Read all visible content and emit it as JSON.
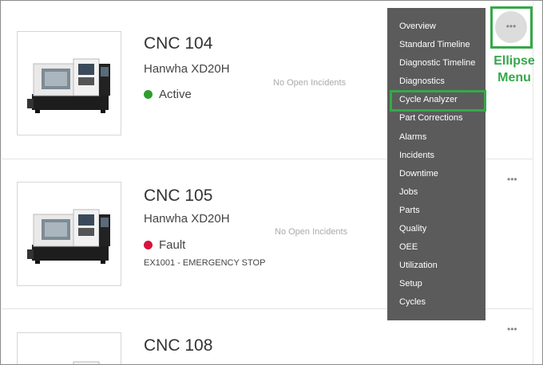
{
  "machines": [
    {
      "name": "CNC 104",
      "model": "Hanwha  XD20H",
      "status": "Active",
      "status_color": "#2e9e2e",
      "incidents": "No Open Incidents",
      "fault": ""
    },
    {
      "name": "CNC 105",
      "model": "Hanwha  XD20H",
      "status": "Fault",
      "status_color": "#d8143c",
      "incidents": "No Open Incidents",
      "fault": "EX1001 - EMERGENCY STOP"
    },
    {
      "name": "CNC 108",
      "model": "",
      "status": "",
      "incidents": "",
      "fault": ""
    }
  ],
  "ellipse_icon": "•••",
  "menu": {
    "items": [
      "Overview",
      "Standard Timeline",
      "Diagnostic Timeline",
      "Diagnostics",
      "Cycle Analyzer",
      "Part Corrections",
      "Alarms",
      "Incidents",
      "Downtime",
      "Jobs",
      "Parts",
      "Quality",
      "OEE",
      "Utilization",
      "Setup",
      "Cycles"
    ],
    "highlighted": "Cycle Analyzer"
  },
  "annotation": {
    "line1": "Ellipse",
    "line2": "Menu",
    "color": "#36a84a"
  }
}
